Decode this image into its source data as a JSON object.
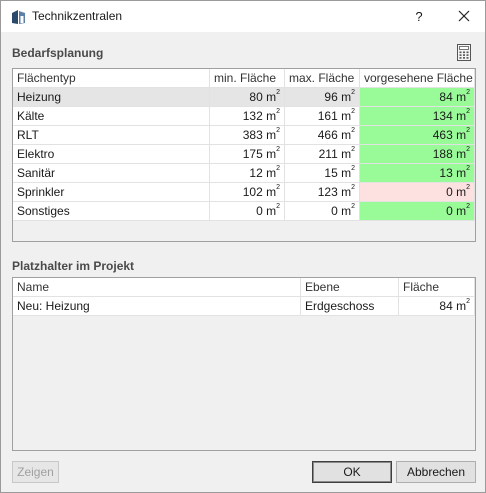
{
  "window": {
    "title": "Technikzentralen",
    "help_label": "?"
  },
  "sections": {
    "requirements_title": "Bedarfsplanung",
    "placeholders_title": "Platzhalter im Projekt"
  },
  "requirements_table": {
    "headers": [
      "Flächentyp",
      "min. Fläche",
      "max. Fläche",
      "vorgesehene Fläche"
    ],
    "unit": "m",
    "unit_exp": "2",
    "rows": [
      {
        "type": "Heizung",
        "min": "80",
        "max": "96",
        "planned": "84",
        "status": "ok",
        "selected": true
      },
      {
        "type": "Kälte",
        "min": "132",
        "max": "161",
        "planned": "134",
        "status": "ok",
        "selected": false
      },
      {
        "type": "RLT",
        "min": "383",
        "max": "466",
        "planned": "463",
        "status": "ok",
        "selected": false
      },
      {
        "type": "Elektro",
        "min": "175",
        "max": "211",
        "planned": "188",
        "status": "ok",
        "selected": false
      },
      {
        "type": "Sanitär",
        "min": "12",
        "max": "15",
        "planned": "13",
        "status": "ok",
        "selected": false
      },
      {
        "type": "Sprinkler",
        "min": "102",
        "max": "123",
        "planned": "0",
        "status": "under",
        "selected": false
      },
      {
        "type": "Sonstiges",
        "min": "0",
        "max": "0",
        "planned": "0",
        "status": "ok",
        "selected": false
      }
    ]
  },
  "placeholders_table": {
    "headers": [
      "Name",
      "Ebene",
      "Fläche"
    ],
    "rows": [
      {
        "name": "Neu: Heizung",
        "level": "Erdgeschoss",
        "area": "84"
      }
    ]
  },
  "buttons": {
    "show": "Zeigen",
    "ok": "OK",
    "cancel": "Abbrechen"
  },
  "colors": {
    "ok": "#98fb98",
    "under": "#fde1e1",
    "selected_row": "#e5e5e5"
  },
  "icons": {
    "app": "building-icon",
    "close": "close-icon",
    "calculator": "calculator-icon"
  }
}
